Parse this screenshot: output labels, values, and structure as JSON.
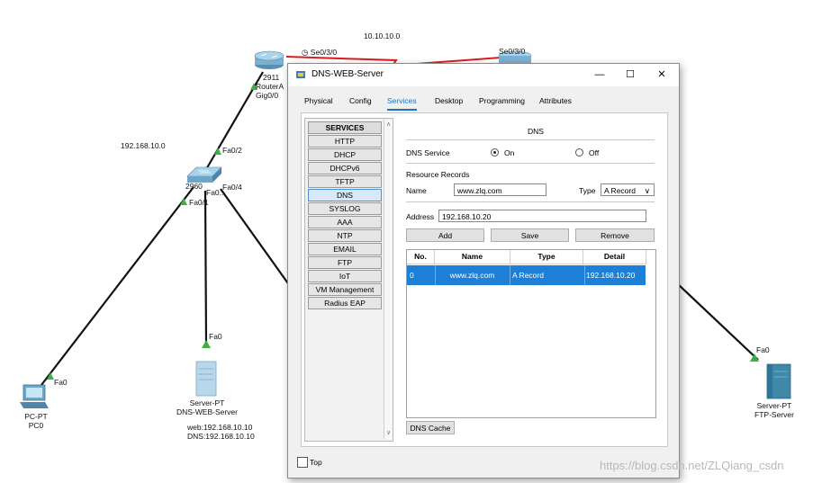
{
  "topology": {
    "link_label_top": "10.10.10.0",
    "routerA": {
      "model": "2911",
      "name": "RouterA",
      "port_gig": "Gig0/0",
      "port_serial": "Se0/3/0"
    },
    "routerB": {
      "port_serial": "Se0/3/0"
    },
    "subnet_label": "192.168.10.0",
    "switch": {
      "model": "2960",
      "port_fa02": "Fa0/2",
      "port_fa04": "Fa0/4",
      "port_fa01": "Fa0/1",
      "port_fa0x": "Fa0..."
    },
    "pc": {
      "type": "PC-PT",
      "name": "PC0",
      "port": "Fa0"
    },
    "dns_server": {
      "type": "Server-PT",
      "name": "DNS-WEB-Server",
      "port": "Fa0",
      "note_web": "web:192.168.10.10",
      "note_dns": "DNS:192.168.10.10"
    },
    "ftp_server": {
      "type": "Server-PT",
      "name": "FTP-Server",
      "port": "Fa0"
    },
    "link_colors": {
      "lan": "#111111",
      "serial": "#d81e1e",
      "port_up": "#3cb043"
    }
  },
  "window": {
    "title": "DNS-WEB-Server",
    "minimize": "—",
    "maximize": "☐",
    "close": "✕",
    "tabs": [
      "Physical",
      "Config",
      "Services",
      "Desktop",
      "Programming",
      "Attributes"
    ],
    "active_tab": "Services",
    "top_checkbox_label": "Top"
  },
  "services": {
    "header": "SERVICES",
    "items": [
      "HTTP",
      "DHCP",
      "DHCPv6",
      "TFTP",
      "DNS",
      "SYSLOG",
      "AAA",
      "NTP",
      "EMAIL",
      "FTP",
      "IoT",
      "VM Management",
      "Radius EAP"
    ],
    "selected": "DNS"
  },
  "dns": {
    "section_title": "DNS",
    "service_label": "DNS Service",
    "on_label": "On",
    "off_label": "Off",
    "service_state": "On",
    "resource_records_label": "Resource Records",
    "name_label": "Name",
    "name_value": "www.zlq.com",
    "type_label": "Type",
    "type_value": "A Record",
    "address_label": "Address",
    "address_value": "192.168.10.20",
    "add_button": "Add",
    "save_button": "Save",
    "remove_button": "Remove",
    "table_headers": [
      "No.",
      "Name",
      "Type",
      "Detail"
    ],
    "records": [
      {
        "no": "0",
        "name": "www.zlq.com",
        "type": "A Record",
        "detail": "192.168.10.20"
      }
    ],
    "cache_button": "DNS Cache"
  },
  "watermark": "https://blog.csdn.net/ZLQiang_csdn",
  "colors": {
    "accent": "#1e7fd6",
    "tab_active": "#1a73c9"
  }
}
